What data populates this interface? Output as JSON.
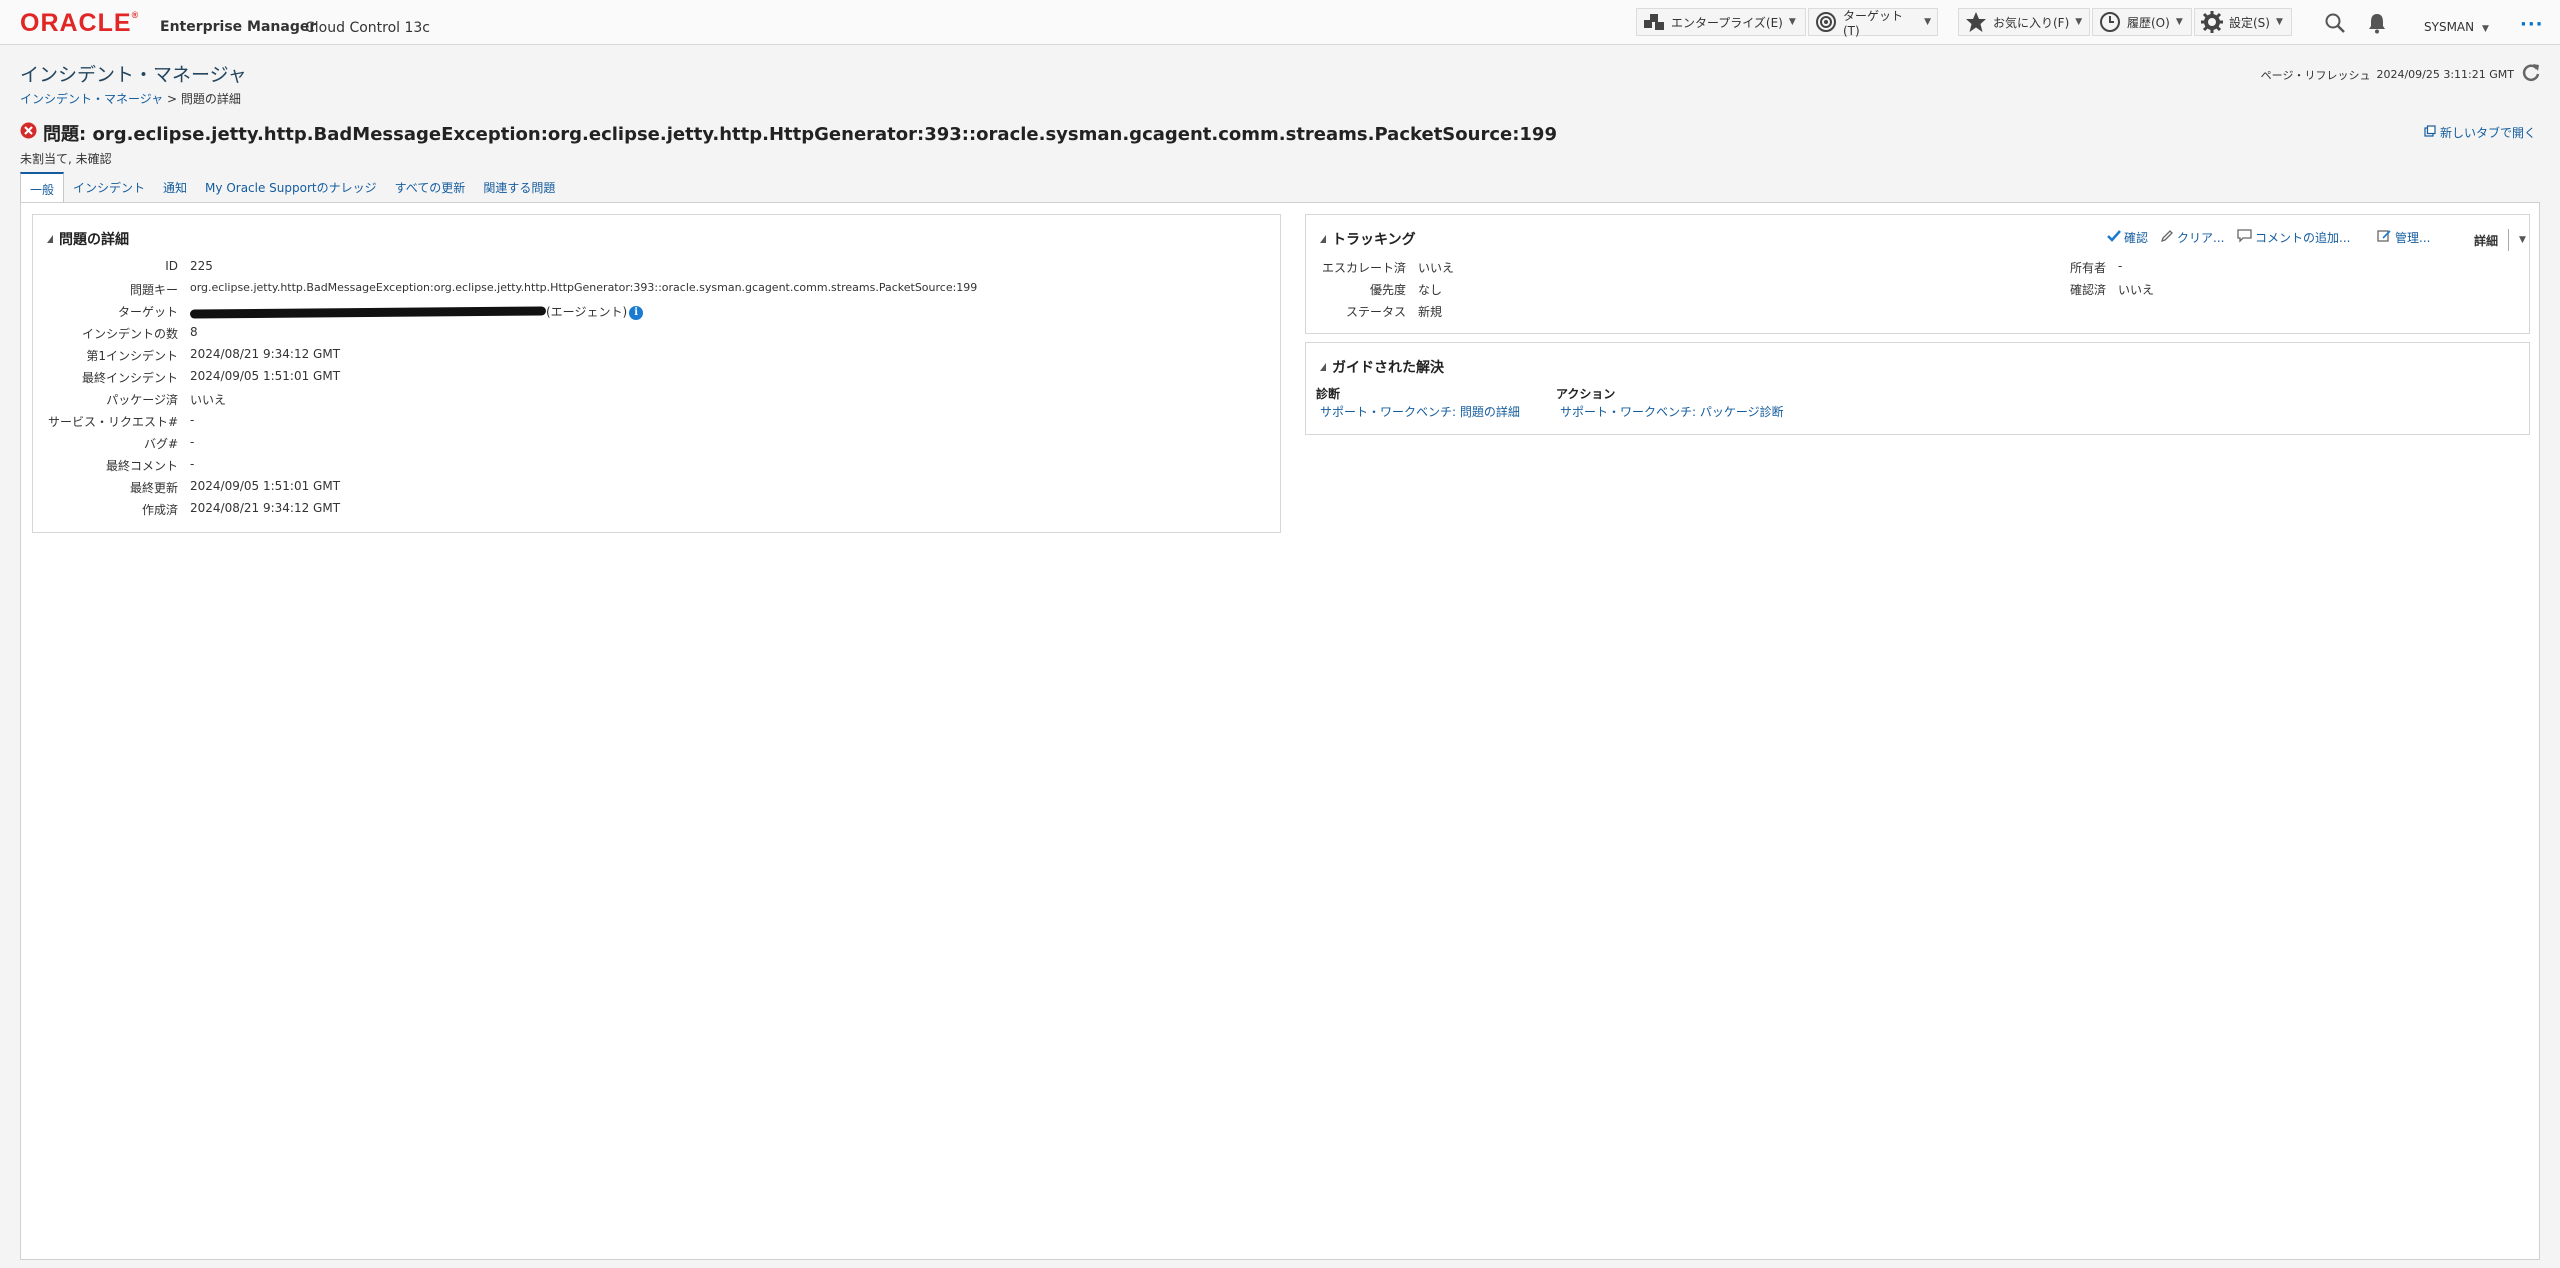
{
  "header": {
    "brand": "ORACLE",
    "product": "Enterprise Manager",
    "edition": "Cloud Control 13c",
    "menus": [
      {
        "label": "エンタープライズ(E)",
        "icon": "enterprise-icon"
      },
      {
        "label": "ターゲット(T)",
        "icon": "target-icon"
      },
      {
        "label": "お気に入り(F)",
        "icon": "star-icon"
      },
      {
        "label": "履歴(O)",
        "icon": "clock-icon"
      },
      {
        "label": "設定(S)",
        "icon": "gear-icon"
      }
    ],
    "user": "SYSMAN",
    "more": "···"
  },
  "page": {
    "title": "インシデント・マネージャ",
    "breadcrumb": {
      "link": "インシデント・マネージャ",
      "sep": ">",
      "current": "問題の詳細"
    },
    "refresh_label": "ページ・リフレッシュ",
    "refresh_time": "2024/09/25 3:11:21 GMT",
    "problem_title": "問題: org.eclipse.jetty.http.BadMessageException:org.eclipse.jetty.http.HttpGenerator:393::oracle.sysman.gcagent.comm.streams.PacketSource:199",
    "problem_status": "未割当て, 未確認",
    "open_new_tab": "新しいタブで開く"
  },
  "tabs": [
    "一般",
    "インシデント",
    "通知",
    "My Oracle Supportのナレッジ",
    "すべての更新",
    "関連する問題"
  ],
  "details": {
    "title": "問題の詳細",
    "rows": [
      {
        "label": "ID",
        "value": "225"
      },
      {
        "label": "問題キー",
        "value": "org.eclipse.jetty.http.BadMessageException:org.eclipse.jetty.http.HttpGenerator:393::oracle.sysman.gcagent.comm.streams.PacketSource:199"
      },
      {
        "label": "ターゲット",
        "value": "(エージェント)"
      },
      {
        "label": "インシデントの数",
        "value": "8"
      },
      {
        "label": "第1インシデント",
        "value": "2024/08/21 9:34:12 GMT"
      },
      {
        "label": "最終インシデント",
        "value": "2024/09/05 1:51:01 GMT"
      },
      {
        "label": "パッケージ済",
        "value": "いいえ"
      },
      {
        "label": "サービス・リクエスト#",
        "value": "-"
      },
      {
        "label": "バグ#",
        "value": "-"
      },
      {
        "label": "最終コメント",
        "value": "-"
      },
      {
        "label": "最終更新",
        "value": "2024/09/05 1:51:01 GMT"
      },
      {
        "label": "作成済",
        "value": "2024/08/21 9:34:12 GMT"
      }
    ]
  },
  "tracking": {
    "title": "トラッキング",
    "actions": [
      "確認",
      "クリア...",
      "コメントの追加...",
      "管理..."
    ],
    "detail_menu": "詳細",
    "left": [
      {
        "label": "エスカレート済",
        "value": "いいえ"
      },
      {
        "label": "優先度",
        "value": "なし"
      },
      {
        "label": "ステータス",
        "value": "新規"
      }
    ],
    "right": [
      {
        "label": "所有者",
        "value": "-"
      },
      {
        "label": "確認済",
        "value": "いいえ"
      }
    ]
  },
  "guided": {
    "title": "ガイドされた解決",
    "diag_header": "診断",
    "diag_link": "サポート・ワークベンチ: 問題の詳細",
    "action_header": "アクション",
    "action_link": "サポート・ワークベンチ: パッケージ診断"
  }
}
